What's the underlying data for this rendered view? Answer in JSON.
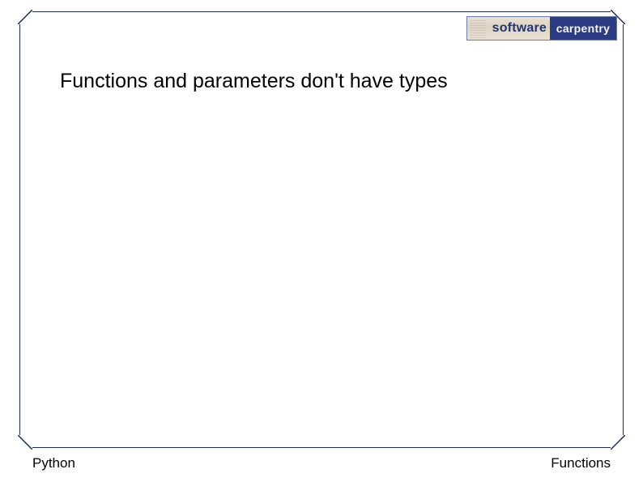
{
  "logo": {
    "left_text": "software",
    "right_text": "carpentry"
  },
  "heading": "Functions and parameters don't have types",
  "footer": {
    "left": "Python",
    "right": "Functions"
  }
}
